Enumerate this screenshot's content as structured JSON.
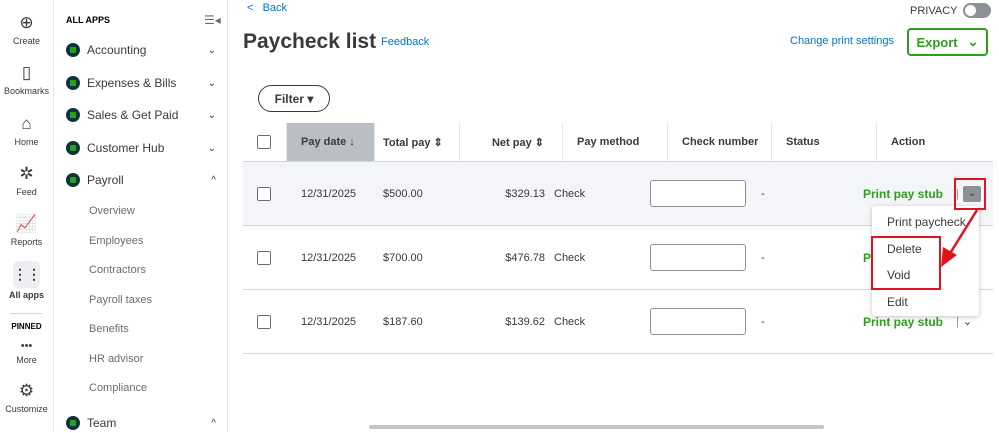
{
  "rail": [
    {
      "label": "Create",
      "icon": "⊕"
    },
    {
      "label": "Bookmarks",
      "icon": "▯"
    },
    {
      "label": "Home",
      "icon": "⌂"
    },
    {
      "label": "Feed",
      "icon": "✲"
    },
    {
      "label": "Reports",
      "icon": "📈"
    },
    {
      "label": "All apps",
      "icon": "⋮⋮"
    },
    {
      "label": "PINNED"
    },
    {
      "label": "More",
      "icon": "•••"
    },
    {
      "label": "Customize",
      "icon": "⚙"
    }
  ],
  "nav": {
    "header": "ALL APPS",
    "apps": [
      {
        "label": "Accounting",
        "chev": "⌄"
      },
      {
        "label": "Expenses & Bills",
        "chev": "⌄"
      },
      {
        "label": "Sales & Get Paid",
        "chev": "⌄"
      },
      {
        "label": "Customer Hub",
        "chev": "⌄"
      },
      {
        "label": "Payroll",
        "chev": "^"
      },
      {
        "label": "Team",
        "chev": "^"
      }
    ],
    "payroll_items": [
      "Overview",
      "Employees",
      "Contractors",
      "Payroll taxes",
      "Benefits",
      "HR advisor",
      "Compliance"
    ]
  },
  "main": {
    "back": "Back",
    "title": "Paycheck list",
    "feedback": "Feedback",
    "privacy": "PRIVACY",
    "change_print": "Change print settings",
    "export": "Export",
    "filter": "Filter ▾"
  },
  "table": {
    "headers": [
      "Pay date ↓",
      "Total pay ⇕",
      "Net pay ⇕",
      "Pay method",
      "Check number",
      "Status",
      "Action"
    ],
    "rows": [
      {
        "date": "12/31/2025",
        "total": "$500.00",
        "net": "$329.13",
        "method": "Check",
        "status": "-",
        "action": "Print pay stub"
      },
      {
        "date": "12/31/2025",
        "total": "$700.00",
        "net": "$476.78",
        "method": "Check",
        "status": "-",
        "action": "Print pay stub"
      },
      {
        "date": "12/31/2025",
        "total": "$187.60",
        "net": "$139.62",
        "method": "Check",
        "status": "-",
        "action": "Print pay stub"
      }
    ]
  },
  "menu": [
    "Print paycheck",
    "Delete",
    "Void",
    "Edit"
  ]
}
